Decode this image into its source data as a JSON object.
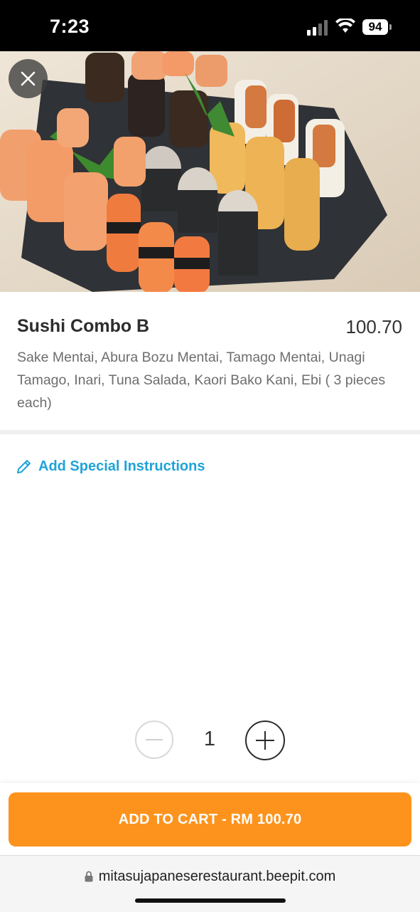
{
  "status_bar": {
    "time": "7:23",
    "battery": "94"
  },
  "product": {
    "title": "Sushi Combo B",
    "price": "100.70",
    "description": "Sake Mentai, Abura Bozu Mentai, Tamago Mentai, Unagi Tamago, Inari, Tuna Salada, Kaori Bako Kani, Ebi ( 3 pieces each)"
  },
  "special_instructions": {
    "label": "Add Special Instructions",
    "icon": "pencil-icon"
  },
  "quantity": {
    "value": "1"
  },
  "cart": {
    "label": "ADD TO CART - RM 100.70"
  },
  "browser": {
    "url": "mitasujapaneserestaurant.beepit.com"
  },
  "colors": {
    "accent": "#fd931c",
    "link": "#1fa3d8"
  }
}
